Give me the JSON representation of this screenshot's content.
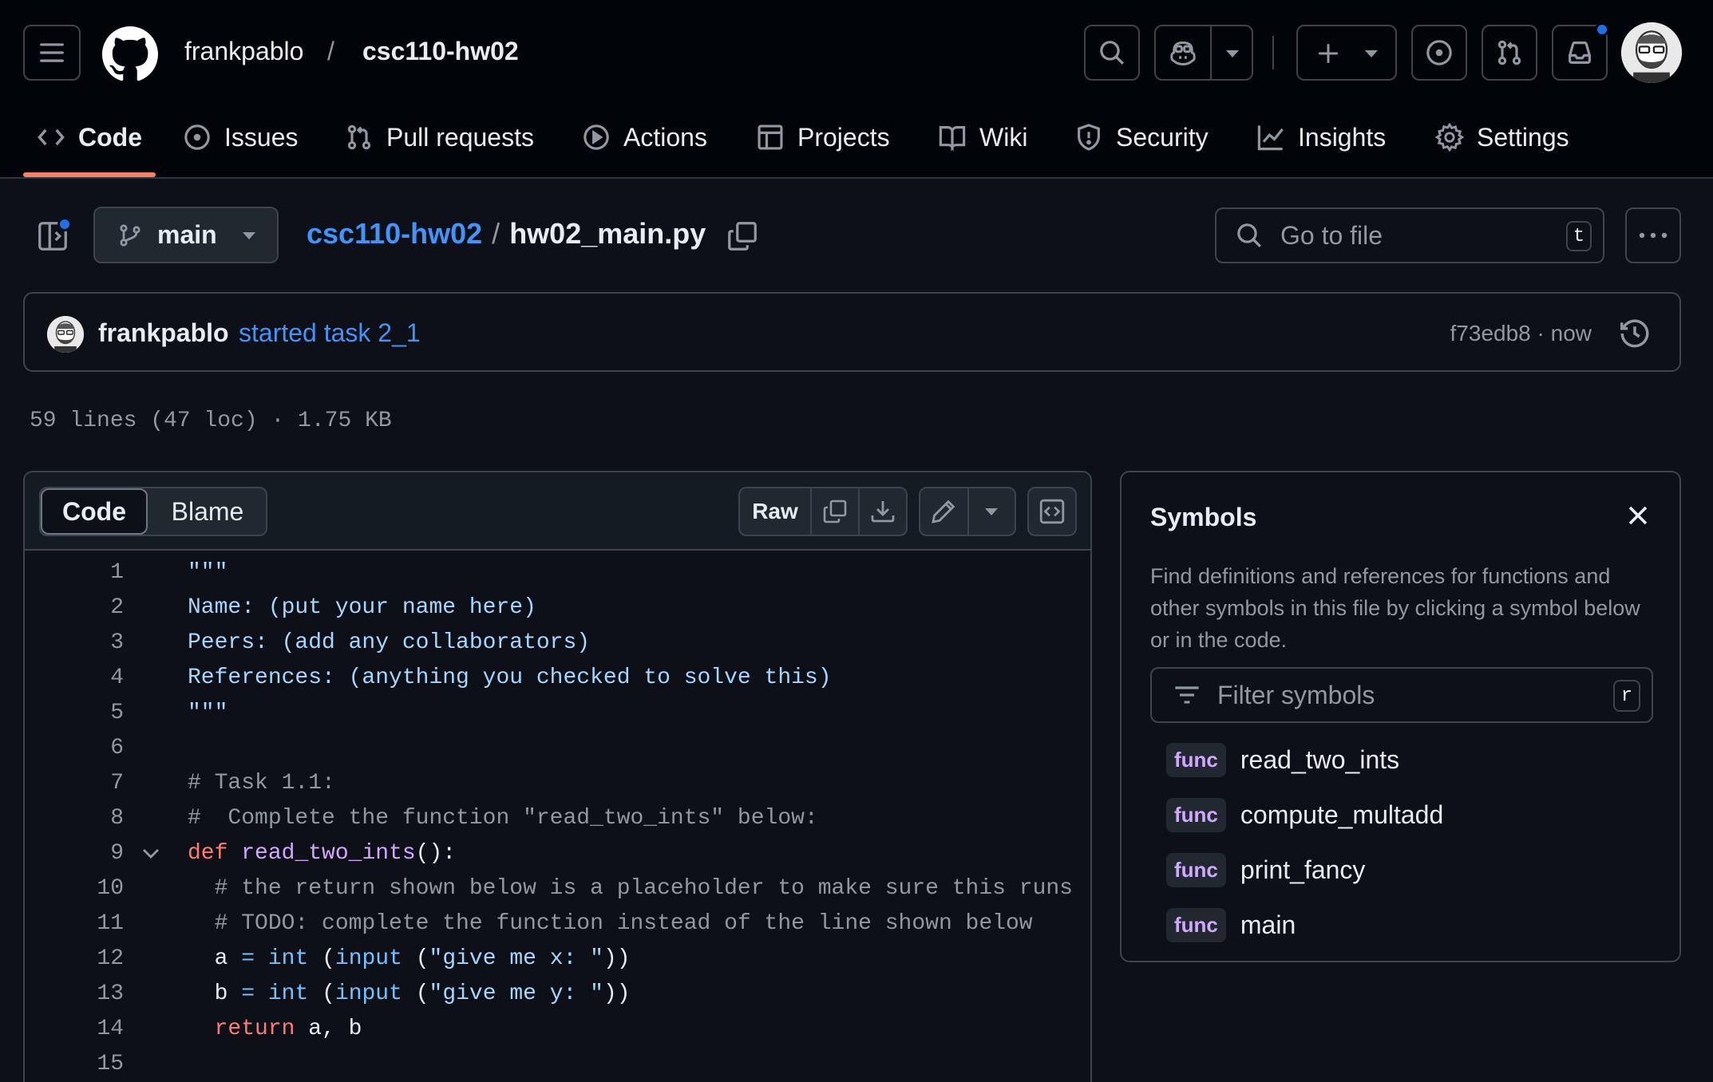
{
  "header": {
    "owner": "frankpablo",
    "separator": "/",
    "repo": "csc110-hw02",
    "icons": [
      "hamburger-icon",
      "github-logo-icon",
      "search-icon",
      "copilot-icon",
      "plus-icon",
      "issues-icon",
      "pull-requests-icon",
      "inbox-icon"
    ]
  },
  "tabs": [
    {
      "label": "Code",
      "icon": "code-icon",
      "selected": true
    },
    {
      "label": "Issues",
      "icon": "issue-opened-icon"
    },
    {
      "label": "Pull requests",
      "icon": "git-pull-request-icon"
    },
    {
      "label": "Actions",
      "icon": "play-icon"
    },
    {
      "label": "Projects",
      "icon": "table-icon"
    },
    {
      "label": "Wiki",
      "icon": "book-icon"
    },
    {
      "label": "Security",
      "icon": "shield-icon"
    },
    {
      "label": "Insights",
      "icon": "graph-icon"
    },
    {
      "label": "Settings",
      "icon": "gear-icon"
    }
  ],
  "file_nav": {
    "branch": "main",
    "repo_link": "csc110-hw02",
    "path_sep": "/",
    "filename": "hw02_main.py",
    "goto_placeholder": "Go to file",
    "goto_shortcut": "t"
  },
  "commit": {
    "author": "frankpablo",
    "message": "started task 2_1",
    "meta": "f73edb8 · now"
  },
  "file_stats": "59 lines (47 loc) · 1.75 KB",
  "code_toolbar": {
    "code_tab": "Code",
    "blame_tab": "Blame",
    "raw": "Raw"
  },
  "accent_colors": {
    "link": "#4493f8",
    "tab_underline": "#f78166",
    "notification": "#1f6feb"
  },
  "code_lines": [
    {
      "n": "1",
      "text": "\"\"\""
    },
    {
      "n": "2",
      "text": "Name: (put your name here)"
    },
    {
      "n": "3",
      "text": "Peers: (add any collaborators)"
    },
    {
      "n": "4",
      "text": "References: (anything you checked to solve this)"
    },
    {
      "n": "5",
      "text": "\"\"\""
    },
    {
      "n": "6",
      "text": ""
    },
    {
      "n": "7",
      "text": "# Task 1.1:"
    },
    {
      "n": "8",
      "text": "#  Complete the function \"read_two_ints\" below:"
    },
    {
      "n": "9",
      "kw": "def",
      "fn": "read_two_ints",
      "rest": "():"
    },
    {
      "n": "10",
      "text": "  # the return shown below is a placeholder to make sure this runs"
    },
    {
      "n": "11",
      "text": "  # TODO: complete the function instead of the line shown below"
    },
    {
      "n": "12",
      "v": "  a",
      "eq": "=",
      "b1": "int",
      "b2": "input",
      "s": "\"give me x: \"",
      "close": "))"
    },
    {
      "n": "13",
      "v": "  b",
      "eq": "=",
      "b1": "int",
      "b2": "input",
      "s": "\"give me y: \"",
      "close": "))"
    },
    {
      "n": "14",
      "kw": "  return",
      "rest": "a, b"
    },
    {
      "n": "15",
      "text": ""
    }
  ],
  "symbols": {
    "title": "Symbols",
    "description": "Find definitions and references for functions and other symbols in this file by clicking a symbol below or in the code.",
    "filter_placeholder": "Filter symbols",
    "filter_shortcut": "r",
    "items": [
      {
        "kind": "func",
        "name": "read_two_ints"
      },
      {
        "kind": "func",
        "name": "compute_multadd"
      },
      {
        "kind": "func",
        "name": "print_fancy"
      },
      {
        "kind": "func",
        "name": "main"
      }
    ]
  }
}
